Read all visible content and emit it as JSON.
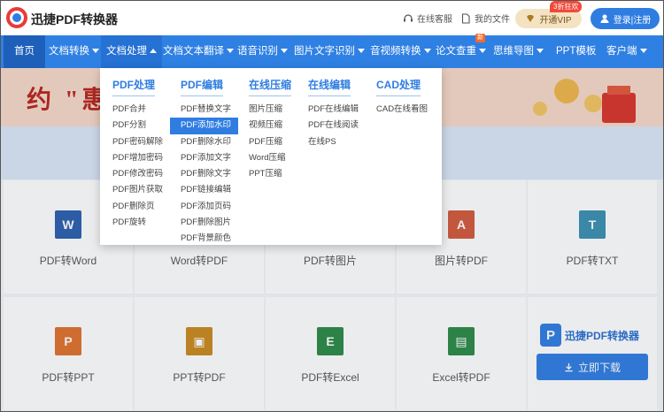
{
  "header": {
    "logo_text": "迅捷PDF转换器",
    "online_service": "在线客服",
    "my_files": "我的文件",
    "vip_label": "开通VIP",
    "vip_badge": "3折狂欢",
    "login_label": "登录|注册"
  },
  "nav": {
    "home": "首页",
    "items": [
      "文档转换",
      "文档处理",
      "文档文本翻译",
      "语音识别",
      "图片文字识别",
      "音视频转换",
      "论文查重",
      "思维导图",
      "PPT模板",
      "客户端"
    ],
    "new_badge": "新"
  },
  "banner": {
    "text": "约 \"惠"
  },
  "dropdown": {
    "columns": [
      {
        "title": "PDF处理",
        "items": [
          "PDF合并",
          "PDF分割",
          "PDF密码解除",
          "PDF增加密码",
          "PDF修改密码",
          "PDF图片获取",
          "PDF删除页",
          "PDF旋转"
        ]
      },
      {
        "title": "PDF编辑",
        "items": [
          "PDF替换文字",
          "PDF添加水印",
          "PDF删除水印",
          "PDF添加文字",
          "PDF删除文字",
          "PDF链接编辑",
          "PDF添加页码",
          "PDF删除图片",
          "PDF背景颜色"
        ],
        "highlighted": "PDF添加水印"
      },
      {
        "title": "在线压缩",
        "items": [
          "图片压缩",
          "视频压缩",
          "PDF压缩",
          "Word压缩",
          "PPT压缩"
        ]
      },
      {
        "title": "在线编辑",
        "items": [
          "PDF在线编辑",
          "PDF在线阅读",
          "在线PS"
        ]
      },
      {
        "title": "CAD处理",
        "items": [
          "CAD在线看图"
        ]
      }
    ]
  },
  "tools": [
    {
      "label": "PDF转Word",
      "glyph": "W",
      "color": "#2b5fad"
    },
    {
      "label": "Word转PDF",
      "glyph": "",
      "color": "#c2410c"
    },
    {
      "label": "PDF转图片",
      "glyph": "",
      "color": "#2b8a57"
    },
    {
      "label": "图片转PDF",
      "glyph": "A",
      "color": "#d35a3c"
    },
    {
      "label": "PDF转TXT",
      "glyph": "T",
      "color": "#3a8fb0"
    },
    {
      "label": "PDF转PPT",
      "glyph": "P",
      "color": "#e0712c"
    },
    {
      "label": "PPT转PDF",
      "glyph": "▣",
      "color": "#c98a1e"
    },
    {
      "label": "PDF转Excel",
      "glyph": "E",
      "color": "#2b8a46"
    },
    {
      "label": "Excel转PDF",
      "glyph": "▤",
      "color": "#2b8a46"
    }
  ],
  "promo": {
    "logo_glyph": "P",
    "title": "迅捷PDF转换器",
    "download": "立即下载"
  }
}
